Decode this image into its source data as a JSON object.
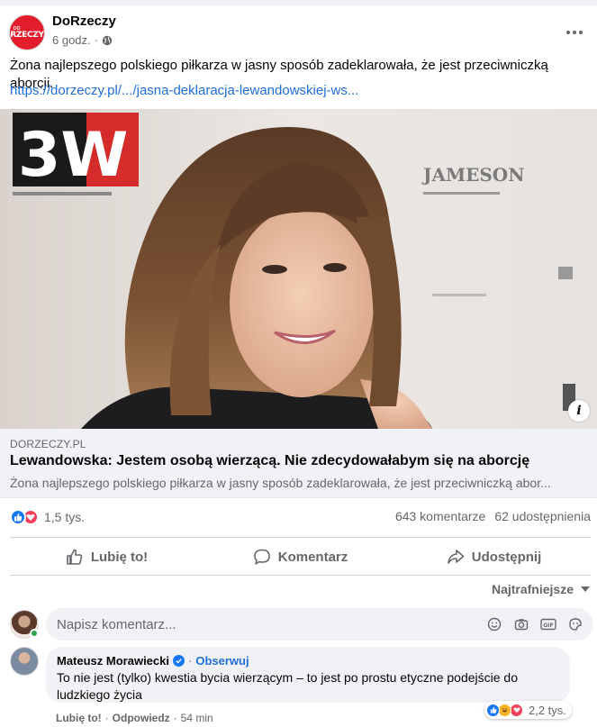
{
  "post": {
    "page_name": "DoRzeczy",
    "logo_text": "RZECZY",
    "logo_small": "DO",
    "time": "6 godz.",
    "separator": "·",
    "text": "Żona najlepszego polskiego piłkarza w jasny sposób zadeklarowała, że jest przeciwniczką aborcji.",
    "link_text": "https://dorzeczy.pl/.../jasna-deklaracja-lewandowskiej-ws...",
    "more_icon": "ellipsis-icon",
    "privacy_icon": "globe-icon"
  },
  "link_preview": {
    "domain": "DORZECZY.PL",
    "title": "Lewandowska: Jestem osobą wierzącą. Nie zdecydowałabym się na aborcję",
    "description": "Żona najlepszego polskiego piłkarza w jasny sposób zadeklarowała, że jest przeciwniczką abor...",
    "image_banner_text": "3W",
    "image_banner_right": "JAMESON",
    "info_label": "i"
  },
  "stats": {
    "reaction_count": "1,5 tys.",
    "comments": "643 komentarze",
    "shares": "62 udostępnienia"
  },
  "actions": {
    "like": "Lubię to!",
    "comment": "Komentarz",
    "share": "Udostępnij"
  },
  "comments_section": {
    "sort_label": "Najtrafniejsze",
    "composer_placeholder": "Napisz komentarz...",
    "composer_icons": [
      "emoji-icon",
      "camera-icon",
      "gif-icon",
      "sticker-icon"
    ],
    "gif_label": "GIF"
  },
  "comment": {
    "author": "Mateusz Morawiecki",
    "follow": "Obserwuj",
    "dot": "·",
    "text": "To nie jest (tylko) kwestia bycia wierzącym – to jest po prostu etyczne podejście do ludzkiego życia",
    "reaction_count": "2,2 tys.",
    "like": "Lubię to!",
    "reply": "Odpowiedz",
    "time": "54 min"
  },
  "colors": {
    "link_blue": "#216fdb",
    "like_blue": "#1877f2",
    "love_red": "#f33e58",
    "brand_red": "#e41d2d",
    "muted_gray": "#65676b"
  }
}
